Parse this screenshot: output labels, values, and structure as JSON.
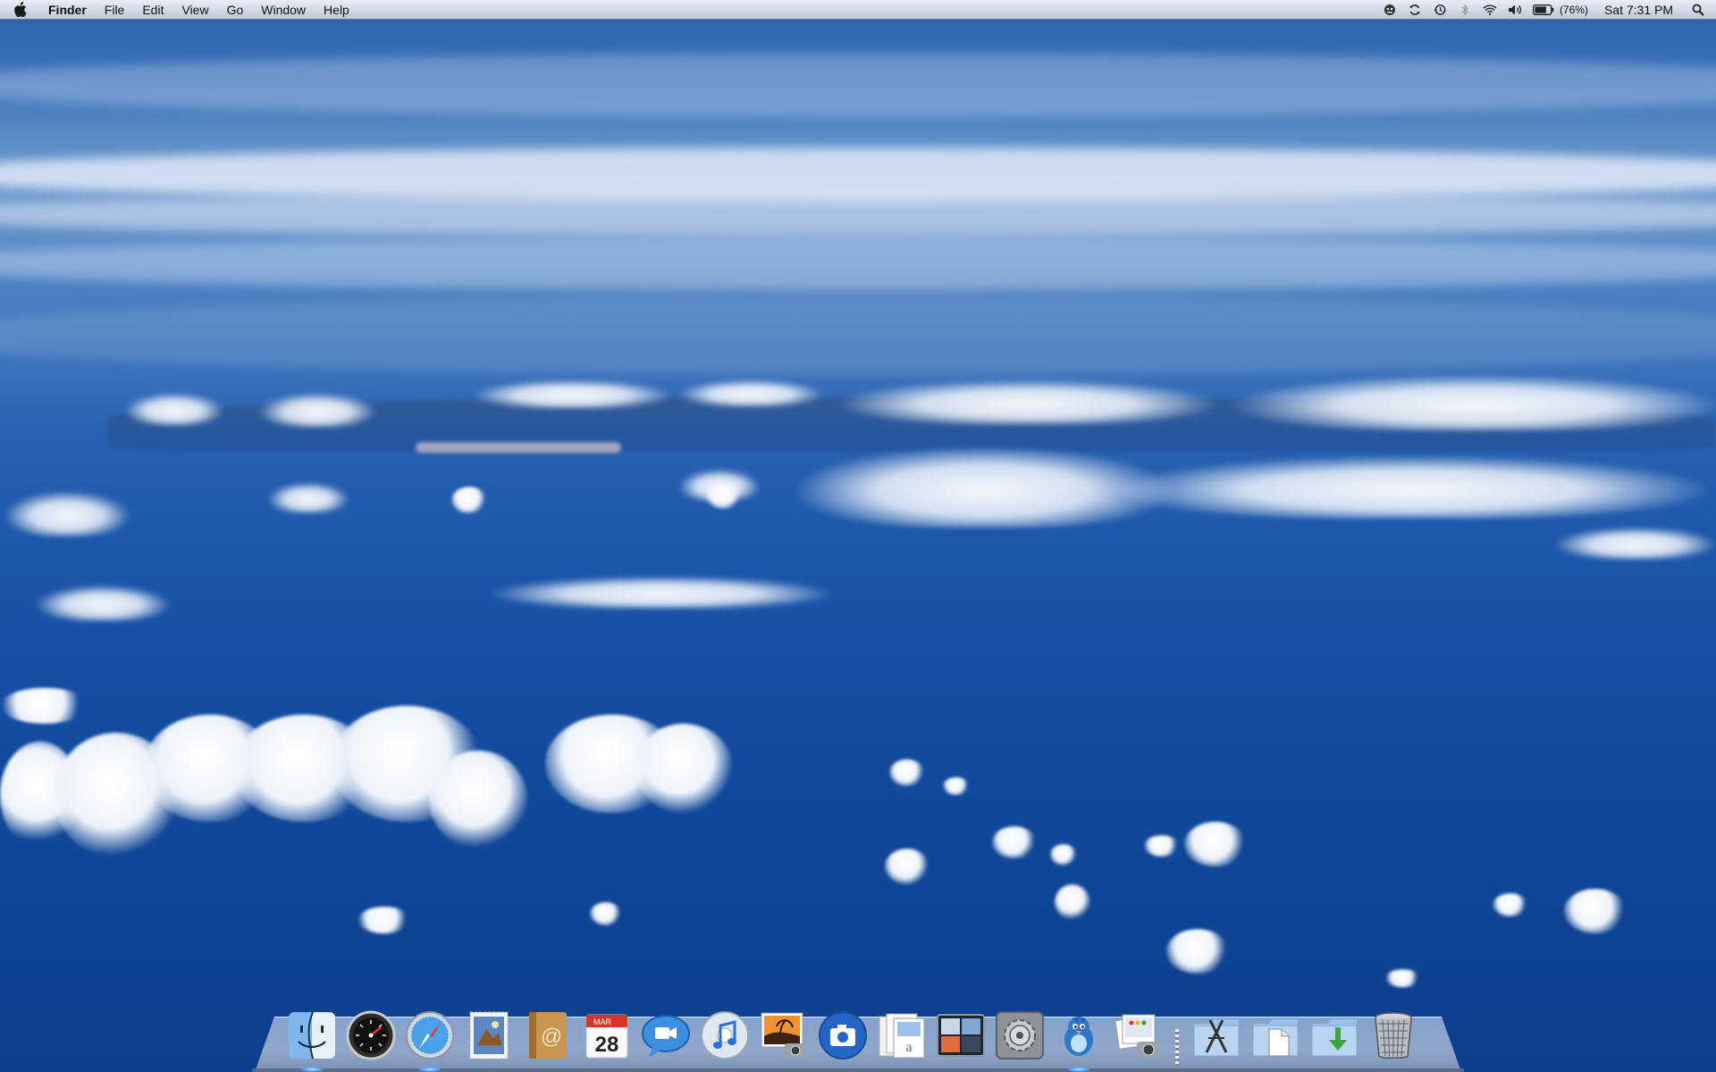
{
  "menubar": {
    "apple_icon": "apple-logo-icon",
    "app_name": "Finder",
    "menus": [
      "File",
      "Edit",
      "View",
      "Go",
      "Window",
      "Help"
    ],
    "status": {
      "icons": [
        "growl-icon",
        "sync-icon",
        "time-machine-icon",
        "bluetooth-icon",
        "wifi-icon",
        "volume-icon",
        "battery-icon"
      ],
      "battery_percent": "(76%)",
      "clock": "Sat 7:31 PM",
      "spotlight_icon": "spotlight-search-icon"
    }
  },
  "dock": {
    "apps": [
      {
        "name": "Finder",
        "icon": "finder-icon",
        "running": true
      },
      {
        "name": "Dashboard",
        "icon": "dashboard-icon",
        "running": false
      },
      {
        "name": "Safari",
        "icon": "safari-compass-icon",
        "running": true
      },
      {
        "name": "Mail",
        "icon": "mail-stamp-icon",
        "running": false
      },
      {
        "name": "Address Book",
        "icon": "address-book-icon",
        "running": false
      },
      {
        "name": "iCal",
        "icon": "calendar-icon",
        "running": false,
        "calendar_month": "MAR",
        "calendar_day": "28"
      },
      {
        "name": "iChat",
        "icon": "ichat-icon",
        "running": false
      },
      {
        "name": "iTunes",
        "icon": "itunes-icon",
        "running": false
      },
      {
        "name": "iPhoto",
        "icon": "iphoto-icon",
        "running": false
      },
      {
        "name": "Image Capture",
        "icon": "camera-icon",
        "running": false
      },
      {
        "name": "Preview",
        "icon": "preview-icon",
        "running": false
      },
      {
        "name": "Spaces",
        "icon": "spaces-icon",
        "running": false
      },
      {
        "name": "System Preferences",
        "icon": "system-preferences-icon",
        "running": false
      },
      {
        "name": "Twitter client",
        "icon": "bird-icon",
        "running": true
      },
      {
        "name": "Image viewer",
        "icon": "photo-viewer-icon",
        "running": false
      }
    ],
    "stacks": [
      {
        "name": "Applications",
        "icon": "applications-folder-icon"
      },
      {
        "name": "Documents",
        "icon": "documents-folder-icon"
      },
      {
        "name": "Downloads",
        "icon": "downloads-folder-icon"
      }
    ],
    "trash": {
      "name": "Trash",
      "icon": "trash-icon"
    }
  },
  "colors": {
    "sky_top": "#2b5fa9",
    "ocean_deep": "#0d3f8c",
    "menubar_top": "#e9eef6",
    "menubar_bottom": "#bcc7d8",
    "running_indicator": "#59a8ff"
  }
}
